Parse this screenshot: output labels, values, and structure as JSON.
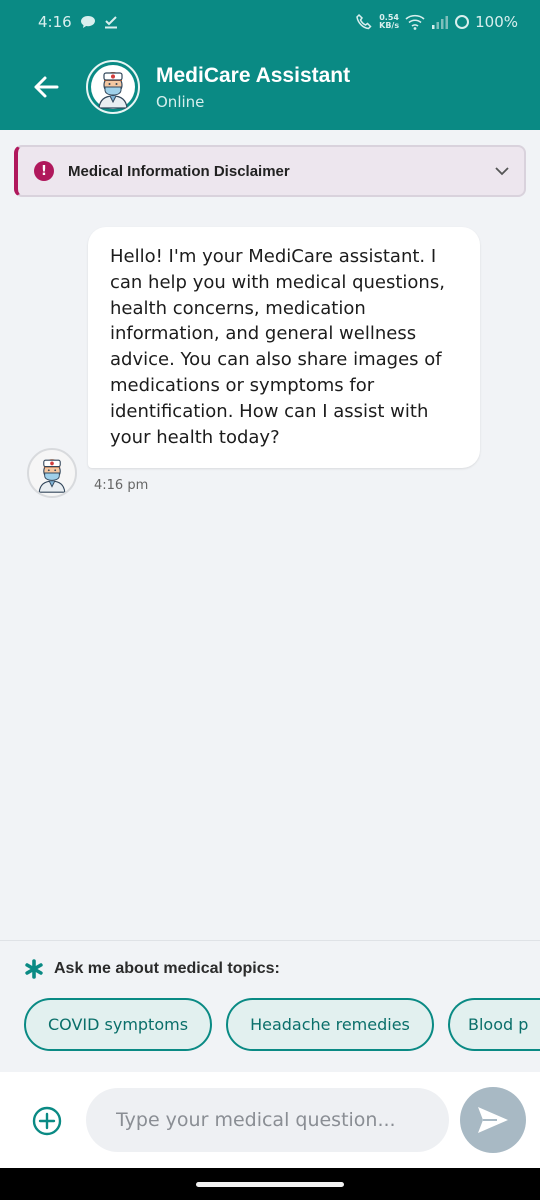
{
  "status_bar": {
    "time": "4:16",
    "net_speed_value": "0.54",
    "net_speed_unit": "KB/s",
    "battery": "100%"
  },
  "header": {
    "title": "MediCare Assistant",
    "status": "Online"
  },
  "disclaimer": {
    "label": "Medical Information Disclaimer"
  },
  "messages": [
    {
      "sender": "assistant",
      "text": "Hello! I'm your MediCare assistant. I can help you with medical questions, health concerns, medication information, and general wellness advice. You can also share images of medications or symptoms for identification. How can I assist with your health today?",
      "time": "4:16 pm"
    }
  ],
  "suggestions": {
    "heading": "Ask me about medical topics:",
    "chips": [
      "COVID symptoms",
      "Headache remedies",
      "Blood p"
    ]
  },
  "composer": {
    "placeholder": "Type your medical question..."
  },
  "colors": {
    "primary": "#0a8a84",
    "disclaimer_accent": "#b0185c",
    "send_disabled": "#a8b9c4"
  }
}
